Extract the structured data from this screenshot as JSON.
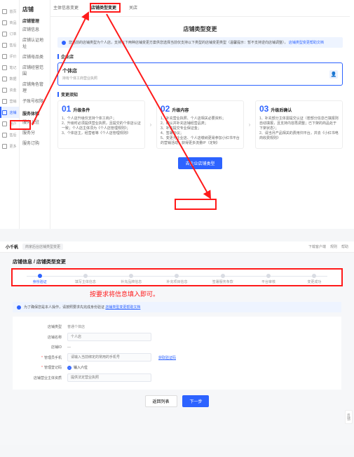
{
  "colors": {
    "accent": "#2d63ff",
    "anno": "#ff1a1a"
  },
  "top": {
    "rail": [
      {
        "icon": "dashboard",
        "label": "首页"
      },
      {
        "icon": "goods",
        "label": "商品"
      },
      {
        "icon": "order",
        "label": "订单"
      },
      {
        "icon": "after",
        "label": "售后"
      },
      {
        "icon": "comment",
        "label": "评价"
      },
      {
        "icon": "note",
        "label": "笔记"
      },
      {
        "icon": "data",
        "label": "数据"
      },
      {
        "icon": "fund",
        "label": "资金"
      },
      {
        "icon": "marketing",
        "label": "营销"
      },
      {
        "icon": "store",
        "label": "店铺",
        "active": true
      },
      {
        "icon": "customer",
        "label": "用户"
      },
      {
        "icon": "service",
        "label": "售后"
      },
      {
        "icon": "more",
        "label": "更多"
      }
    ],
    "submenu": {
      "title": "店铺",
      "group1": "店铺管理",
      "items1": [
        "店铺信息",
        "店铺认证地址",
        "店铺母品类",
        "店铺经营范围",
        "店铺角色管理",
        "子账号权限"
      ],
      "group2": "服务体验",
      "items2": [
        "服务入驻",
        "服务分",
        "服务订购"
      ]
    },
    "tabs": [
      "主体信息变更",
      "店铺类型变更",
      "关店"
    ],
    "active_tab": 1,
    "page_title": "店铺类型变更",
    "alert_text": "您当前的店铺类型为个人店，支持以下两种店铺变更方案供您选择当前仅支持以下类型的店铺变更类型（温馨提示：暂不支持逆向店铺调整），",
    "alert_link": "店铺类型变更帮助文档",
    "sec1": "企业店",
    "type_card": {
      "name": "个体店",
      "desc": "持有个体工商营业执照",
      "badge": "👤"
    },
    "sec2": "变更须知",
    "steps": [
      {
        "num": "01",
        "title": "升级条件",
        "body": "1、个人店升级仅支持个体工商户；\n2、升级时必须提供营业执照，且提交的个体店认证一致；个人店主体须为《个人店管理规则》；\n3、个体店主，经营者等《个人店管理规则》"
      },
      {
        "num": "02",
        "title": "升级内容",
        "body": "1、补充营业执照、个人店相关必要资料；\n2、确认并补充店铺经营品类；\n3、补充提交专业保证金；\n4、签署协议；\n5、变更为企业店、个人店缴纳更易参加小红书平台的营销活动，获得更多流量IP（定制）"
      },
      {
        "num": "03",
        "title": "升级后确认",
        "body": "1、补充部分主体需提交认证（若部分信息已填报则自动填报，且支持内容再调整；已下架的商品处于下架状态）；\n2、请当月产品相关的费用归平台，并去《小红书电商收费规则》"
      }
    ],
    "action_button": "去企业店铺类型"
  },
  "annotation_text": "按要求将信息填入即可。",
  "bottom": {
    "brand": "小千帆",
    "crumb": "商家后台店铺类型变更",
    "top_links": [
      "下载客户端",
      "规则",
      "帮助"
    ],
    "breadcrumb": "店铺信息 / 店铺类型变更",
    "stepper": [
      "身份验证",
      "填写主体信息",
      "补充品牌信息",
      "补充项目信息",
      "签署服务条款",
      "平台审核",
      "变更成功"
    ],
    "active_step": 0,
    "info_alert": "为了确保您是本人操作，请按照要求先完成身份验证",
    "info_alert_link": "店铺类型变更帮助文档",
    "form": {
      "store_type_label": "店铺类型",
      "store_type_value": "普通个体店",
      "store_name_label": "店铺名称",
      "store_name_placeholder": "个人店",
      "store_id_label": "店铺ID",
      "owner_label": "管理员手机",
      "owner_placeholder": "请输入当前绑定的常用的手机号",
      "captcha_link": "获取验证码",
      "sms_label": "管理登记码",
      "sms_hint": "输入六位",
      "id_label": "店铺营业主体资质",
      "id_hint": "提供法定营业执照"
    },
    "buttons": {
      "back": "返回列表",
      "next": "下一步"
    },
    "feedback": "反馈"
  }
}
